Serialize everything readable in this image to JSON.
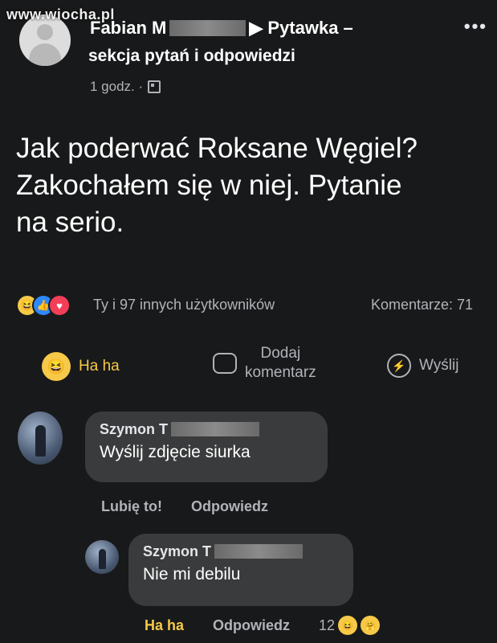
{
  "watermark": "www.wiocha.pl",
  "post": {
    "author_first": "Fabian M",
    "group_arrow": "▶",
    "group_name": "Pytawka –",
    "group_name_line2": "sekcja pytań i odpowiedzi",
    "time": "1 godz. ·",
    "more_label": "•••",
    "text_line1": "Jak poderwać Roksane Węgiel?",
    "text_line2": "Zakochałem się w niej. Pytanie",
    "text_line3": "na serio."
  },
  "reactions": {
    "icons": [
      "haha-icon",
      "like-icon",
      "love-icon"
    ],
    "summary": "Ty i 97 innych użytkowników",
    "comments": "Komentarze: 71"
  },
  "actions": {
    "haha_label": "Ha ha",
    "comment_label_line1": "Dodaj",
    "comment_label_line2": "komentarz",
    "send_label": "Wyślij"
  },
  "comments": [
    {
      "author": "Szymon T",
      "text": "Wyślij zdjęcie siurka",
      "like_label": "Lubię to!",
      "reply_label": "Odpowiedz"
    },
    {
      "author": "Szymon T",
      "text": "Nie mi debilu",
      "haha_label": "Ha ha",
      "reply_label": "Odpowiedz",
      "reaction_count": "12"
    }
  ],
  "colors": {
    "background": "#18191a",
    "bubble": "#3a3b3c",
    "haha_accent": "#f7c948",
    "secondary_text": "#b0b3b8"
  }
}
